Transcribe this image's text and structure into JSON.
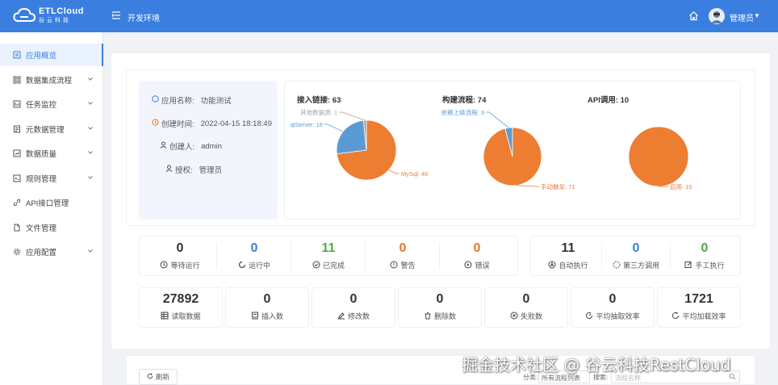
{
  "header": {
    "logo_brand": "ETLCloud",
    "logo_sub": "谷云科技",
    "env_label": "开发环境",
    "user_name": "管理员"
  },
  "sidebar": {
    "items": [
      {
        "label": "应用概览",
        "icon": "overview-icon",
        "active": true,
        "has_children": false
      },
      {
        "label": "数据集成流程",
        "icon": "grid-icon",
        "active": false,
        "has_children": true
      },
      {
        "label": "任务监控",
        "icon": "monitor-icon",
        "active": false,
        "has_children": true
      },
      {
        "label": "元数据管理",
        "icon": "metadata-icon",
        "active": false,
        "has_children": true
      },
      {
        "label": "数据质量",
        "icon": "quality-icon",
        "active": false,
        "has_children": true
      },
      {
        "label": "规则管理",
        "icon": "rule-icon",
        "active": false,
        "has_children": true
      },
      {
        "label": "API接口管理",
        "icon": "link-icon",
        "active": false,
        "has_children": false
      },
      {
        "label": "文件管理",
        "icon": "file-icon",
        "active": false,
        "has_children": false
      },
      {
        "label": "应用配置",
        "icon": "gear-icon",
        "active": false,
        "has_children": true
      }
    ]
  },
  "app_info": {
    "name_label": "应用名称:",
    "name_value": "功能测试",
    "created_label": "创建时间:",
    "created_value": "2022-04-15 18:18:49",
    "creator_label": "创建人:",
    "creator_value": "admin",
    "auth_label": "授权:",
    "auth_value": "管理员"
  },
  "chart_data": [
    {
      "type": "pie",
      "title": "接入链接: 63",
      "slices": [
        {
          "name": "MySql",
          "value": 46,
          "color": "#ed7d31",
          "label": "MySql: 46"
        },
        {
          "name": "qlServer",
          "value": 16,
          "color": "#5b9bd5",
          "label": "qlServer: 16"
        },
        {
          "name": "其他数据源",
          "value": 1,
          "color": "#a5a5a5",
          "label": "其他数据源: 1"
        }
      ]
    },
    {
      "type": "pie",
      "title": "构建流程: 74",
      "slices": [
        {
          "name": "手动触发",
          "value": 71,
          "color": "#ed7d31",
          "label": "手动触发: 71"
        },
        {
          "name": "依赖上级流程",
          "value": 3,
          "color": "#5b9bd5",
          "label": "依赖上级流程: 3"
        }
      ]
    },
    {
      "type": "pie",
      "title": "API调用: 10",
      "slices": [
        {
          "name": "启用",
          "value": 10,
          "color": "#ed7d31",
          "label": "启用: 10"
        }
      ]
    }
  ],
  "run_stats": [
    {
      "value": "0",
      "label": "等待运行",
      "color": "#333333",
      "icon": "clock-icon"
    },
    {
      "value": "0",
      "label": "运行中",
      "color": "#3a7ee0",
      "icon": "loading-icon"
    },
    {
      "value": "11",
      "label": "已完成",
      "color": "#52a84a",
      "icon": "check-circle-icon"
    },
    {
      "value": "0",
      "label": "警告",
      "color": "#e8752c",
      "icon": "warning-icon"
    },
    {
      "value": "0",
      "label": "错误",
      "color": "#e8752c",
      "icon": "error-icon"
    }
  ],
  "exec_stats": [
    {
      "value": "11",
      "label": "自动执行",
      "color": "#333333",
      "icon": "auto-icon"
    },
    {
      "value": "0",
      "label": "第三方调用",
      "color": "#3a7ee0",
      "icon": "third-party-icon"
    },
    {
      "value": "0",
      "label": "手工执行",
      "color": "#52a84a",
      "icon": "manual-icon"
    }
  ],
  "data_stats": [
    {
      "value": "27892",
      "label": "读取数据",
      "icon": "table-icon"
    },
    {
      "value": "0",
      "label": "插入数",
      "icon": "insert-icon"
    },
    {
      "value": "0",
      "label": "修改数",
      "icon": "edit-icon"
    },
    {
      "value": "0",
      "label": "删除数",
      "icon": "delete-icon"
    },
    {
      "value": "0",
      "label": "失败数",
      "icon": "fail-icon"
    },
    {
      "value": "0",
      "label": "平均抽取效率",
      "icon": "speed-icon"
    },
    {
      "value": "1721",
      "label": "平均加载效率",
      "icon": "load-icon"
    }
  ],
  "toolbar": {
    "refresh_label": "刷新",
    "category_label": "分类:",
    "category_value": "所有流程列表",
    "search_label": "搜索:",
    "search_placeholder": "流程名称"
  },
  "watermark": "掘金技术社区 @ 谷云科技RestCloud"
}
